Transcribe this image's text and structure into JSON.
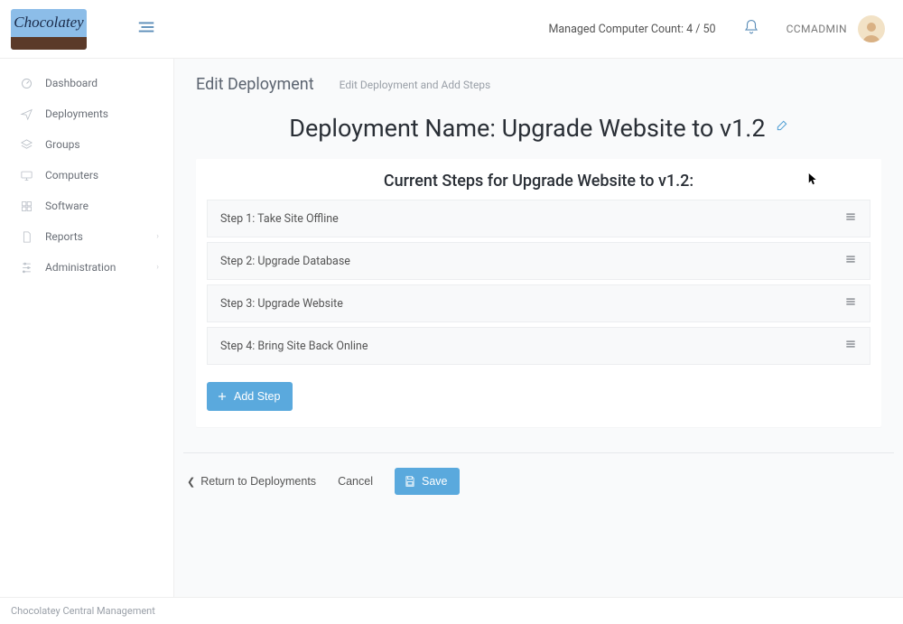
{
  "header": {
    "logo_text": "Chocolatey",
    "managed_count_label": "Managed Computer Count: 4 / 50",
    "username": "CCMADMIN"
  },
  "sidebar": {
    "items": [
      {
        "label": "Dashboard",
        "icon": "dashboard",
        "expandable": false
      },
      {
        "label": "Deployments",
        "icon": "send",
        "expandable": false
      },
      {
        "label": "Groups",
        "icon": "layers",
        "expandable": false
      },
      {
        "label": "Computers",
        "icon": "monitor",
        "expandable": false
      },
      {
        "label": "Software",
        "icon": "grid",
        "expandable": false
      },
      {
        "label": "Reports",
        "icon": "file",
        "expandable": true
      },
      {
        "label": "Administration",
        "icon": "sliders",
        "expandable": true
      }
    ]
  },
  "page": {
    "title": "Edit Deployment",
    "subtitle": "Edit Deployment and Add Steps",
    "deployment_label_prefix": "Deployment Name: ",
    "deployment_name": "Upgrade Website to v1.2",
    "steps_heading": "Current Steps for Upgrade Website to v1.2:",
    "steps": [
      {
        "text": "Step 1: Take Site Offline"
      },
      {
        "text": "Step 2: Upgrade Database"
      },
      {
        "text": "Step 3: Upgrade Website"
      },
      {
        "text": "Step 4: Bring Site Back Online"
      }
    ],
    "add_step_label": "Add Step",
    "return_label": "Return to Deployments",
    "cancel_label": "Cancel",
    "save_label": "Save"
  },
  "footer": {
    "text": "Chocolatey Central Management"
  }
}
